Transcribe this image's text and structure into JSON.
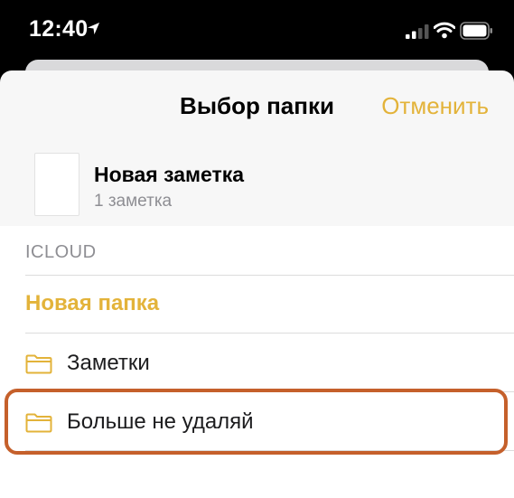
{
  "status_bar": {
    "time": "12:40",
    "icons": [
      "location-arrow-icon",
      "cellular-signal-icon",
      "wifi-icon",
      "battery-icon"
    ]
  },
  "sheet": {
    "title": "Выбор папки",
    "cancel_label": "Отменить",
    "note": {
      "title": "Новая заметка",
      "count": "1 заметка"
    }
  },
  "list": {
    "section_header": "ICLOUD",
    "new_folder_label": "Новая папка",
    "folders": [
      {
        "label": "Заметки",
        "icon": "folder-icon"
      },
      {
        "label": "Больше не удаляй",
        "icon": "folder-icon"
      }
    ]
  },
  "colors": {
    "accent": "#e3b33a",
    "highlight_outline": "#c5602b",
    "secondary_text": "#8e8e93"
  }
}
